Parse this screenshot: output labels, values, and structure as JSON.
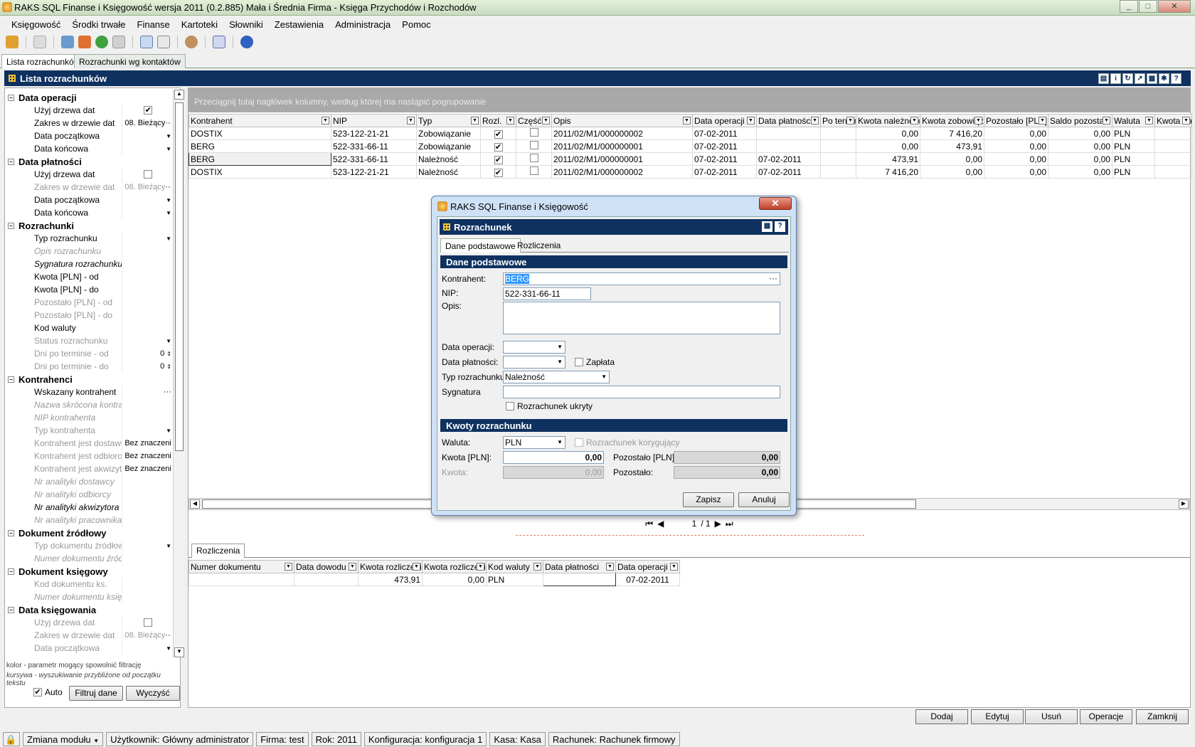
{
  "window": {
    "title": "RAKS SQL Finanse i Księgowość wersja 2011 (0.2.885) Mała i Średnia Firma - Księga Przychodów i Rozchodów"
  },
  "menu": [
    "Księgowość",
    "Środki trwałe",
    "Finanse",
    "Kartoteki",
    "Słowniki",
    "Zestawienia",
    "Administracja",
    "Pomoc"
  ],
  "doc_tabs": [
    "Lista rozrachunków",
    "Rozrachunki wg kontaktów"
  ],
  "main_header": "Lista rozrachunków",
  "filter": {
    "sections": {
      "data_operacji": "Data operacji",
      "data_platnosci": "Data płatności",
      "rozrachunki": "Rozrachunki",
      "kontrahenci": "Kontrahenci",
      "dokument_zrodlowy": "Dokument źródłowy",
      "dokument_ksiegowy": "Dokument księgowy",
      "data_ksiegowania": "Data księgowania"
    },
    "labels": {
      "uzyj_drzewa": "Użyj drzewa dat",
      "zakres_w_drzewie": "Zakres w drzewie dat",
      "zakres_value": "08. Bieżący",
      "data_poczatkowa": "Data początkowa",
      "data_koncowa": "Data końcowa",
      "typ_rozrachunku": "Typ rozrachunku",
      "opis_rozrachunku": "Opis rozrachunku",
      "sygnatura": "Sygnatura rozrachunku",
      "kwota_od": "Kwota [PLN] - od",
      "kwota_do": "Kwota [PLN] - do",
      "pozostalo_od": "Pozostało [PLN] - od",
      "pozostalo_do": "Pozostało [PLN] - do",
      "kod_waluty": "Kod waluty",
      "status": "Status rozrachunku",
      "dni_od": "Dni po terminie - od",
      "dni_do": "Dni po terminie - do",
      "dni_value": "0",
      "wskazany": "Wskazany kontrahent",
      "nazwa_skrocona": "Nazwa skrócona kontrahenta",
      "nip_kontrahenta": "NIP kontrahenta",
      "typ_kontrahenta": "Typ kontrahenta",
      "jest_dostawca": "Kontrahent jest dostawcą",
      "jest_odbiorca": "Kontrahent jest odbiorcą",
      "jest_akwizytor": "Kontrahent jest akwizytorem",
      "bez_znaczenia": "Bez znaczenia",
      "nr_dostawcy": "Nr analityki dostawcy",
      "nr_odbiorcy": "Nr analityki odbiorcy",
      "nr_akwizytora": "Nr analityki akwizytora",
      "nr_pracownika": "Nr analityki pracownika",
      "typ_dokumentu": "Typ dokumentu źródłowego",
      "numer_dokumentu": "Numer dokumentu źródłowego",
      "kod_dokumentu": "Kod dokumentu ks.",
      "numer_dok_ks": "Numer dokumentu księgowego"
    },
    "legend1": "kolor - parametr mogący spowolnić filtrację",
    "legend2": "kursywa - wyszukiwanie przybliżone od początku tekstu",
    "auto_label": "Auto",
    "filter_button": "Filtruj dane",
    "clear_button": "Wyczyść"
  },
  "group_band": "Przeciągnij tutaj nagłówek kolumny, według której ma nastąpić pogrupowanie",
  "grid": {
    "columns": [
      "Kontrahent",
      "NIP",
      "Typ",
      "Rozl.",
      "Część",
      "Opis",
      "Data operacji",
      "Data płatności",
      "Po terminie",
      "Kwota należności",
      "Kwota zobowiązania",
      "Pozostało [PLN]",
      "Saldo pozostało",
      "Waluta",
      "Kwota należności"
    ],
    "rows": [
      [
        "DOSTIX",
        "523-122-21-21",
        "Zobowiązanie",
        "✔",
        "",
        "2011/02/M1/000000002",
        "07-02-2011",
        "",
        "",
        "0,00",
        "7 416,20",
        "0,00",
        "0,00",
        "PLN",
        ""
      ],
      [
        "BERG",
        "522-331-66-11",
        "Zobowiązanie",
        "✔",
        "",
        "2011/02/M1/000000001",
        "07-02-2011",
        "",
        "",
        "0,00",
        "473,91",
        "0,00",
        "0,00",
        "PLN",
        ""
      ],
      [
        "BERG",
        "522-331-66-11",
        "Należność",
        "✔",
        "",
        "2011/02/M1/000000001",
        "07-02-2011",
        "07-02-2011",
        "",
        "473,91",
        "0,00",
        "0,00",
        "0,00",
        "PLN",
        ""
      ],
      [
        "DOSTIX",
        "523-122-21-21",
        "Należność",
        "✔",
        "",
        "2011/02/M1/000000002",
        "07-02-2011",
        "07-02-2011",
        "",
        "7 416,20",
        "0,00",
        "0,00",
        "0,00",
        "PLN",
        ""
      ]
    ]
  },
  "pager": {
    "current": "1",
    "total": "/ 1"
  },
  "bottom": {
    "tab": "Rozliczenia",
    "columns": [
      "Numer dokumentu",
      "Data dowodu",
      "Kwota rozliczenia",
      "Kwota rozliczenia",
      "Kod waluty",
      "Data płatności",
      "Data operacji"
    ],
    "row": [
      "",
      "",
      "473,91",
      "0,00",
      "PLN",
      "",
      "07-02-2011"
    ]
  },
  "dialog": {
    "title": "RAKS SQL Finanse i Księgowość",
    "header": "Rozrachunek",
    "tabs": [
      "Dane podstawowe",
      "Rozliczenia"
    ],
    "section1": "Dane podstawowe",
    "kontrahent_label": "Kontrahent:",
    "kontrahent_value": "BERG",
    "nip_label": "NIP:",
    "nip_value": "522-331-66-11",
    "opis_label": "Opis:",
    "data_operacji_label": "Data operacji:",
    "data_platnosci_label": "Data płatności:",
    "zaplata_label": "Zapłata",
    "typ_label": "Typ rozrachunku:",
    "typ_value": "Należność",
    "sygnatura_label": "Sygnatura",
    "ukryty_label": "Rozrachunek ukryty",
    "section2": "Kwoty rozrachunku",
    "waluta_label": "Waluta:",
    "waluta_value": "PLN",
    "korygujacy_label": "Rozrachunek korygujący",
    "kwota_pln_label": "Kwota [PLN]:",
    "kwota_pln_value": "0,00",
    "pozostalo_pln_label": "Pozostało [PLN]:",
    "pozostalo_pln_value": "0,00",
    "kwota_label": "Kwota:",
    "kwota_value": "0,00",
    "pozostalo_label": "Pozostało:",
    "pozostalo_value": "0,00",
    "save": "Zapisz",
    "cancel": "Anuluj"
  },
  "actions": [
    "Dodaj",
    "Edytuj",
    "Usuń",
    "Operacje",
    "Zamknij"
  ],
  "status": {
    "module": "Zmiana modułu",
    "user": "Użytkownik: Główny administrator",
    "firma": "Firma: test",
    "rok": "Rok: 2011",
    "konfiguracja": "Konfiguracja: konfiguracja 1",
    "kasa": "Kasa: Kasa",
    "rachunek": "Rachunek: Rachunek firmowy"
  }
}
